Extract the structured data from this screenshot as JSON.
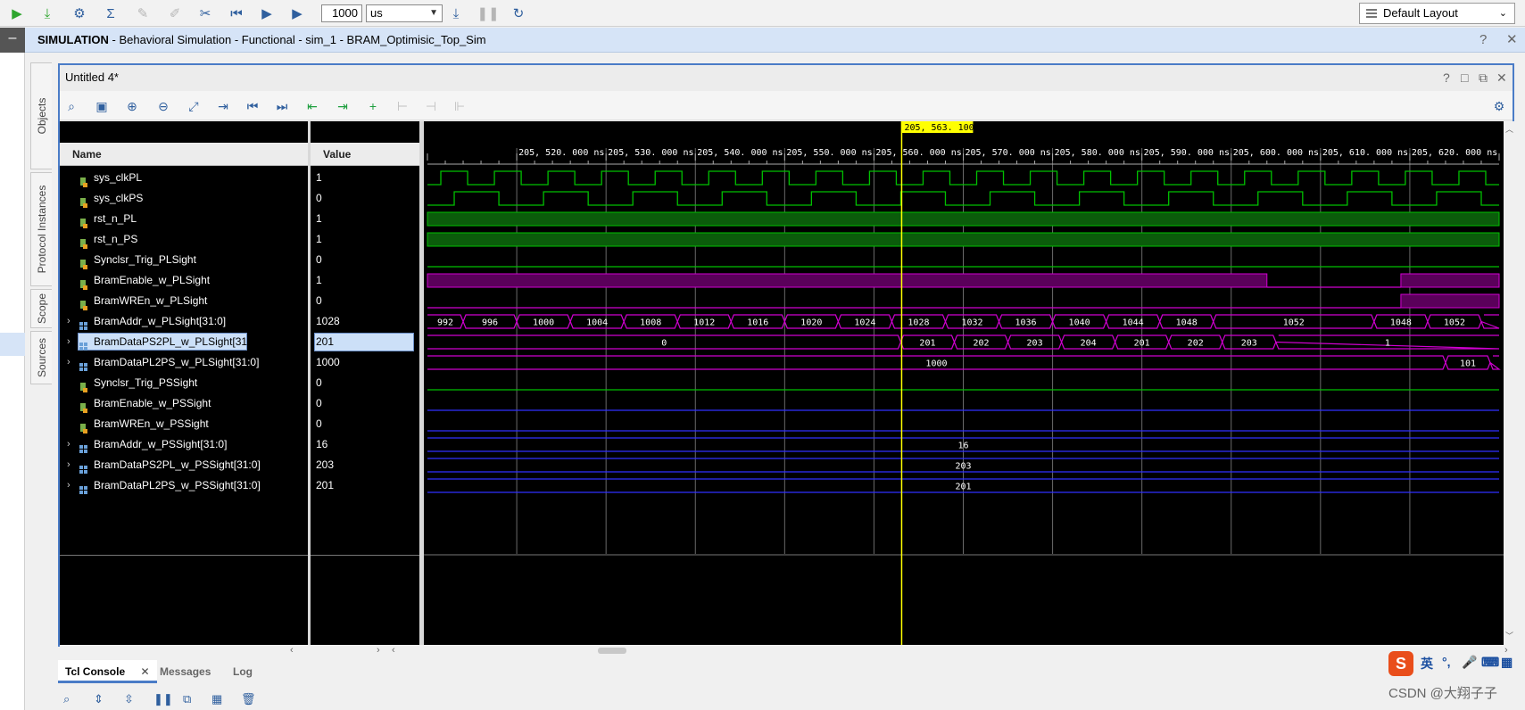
{
  "toolbar": {
    "run_time_value": "1000",
    "run_time_unit": "us",
    "layout": "Default Layout",
    "icons": [
      "run-all-icon",
      "run-step-icon",
      "settings-icon",
      "sigma-icon",
      "disabled-icon",
      "disabled-icon",
      "break-icon",
      "restart-icon",
      "run-icon",
      "run-for-time-icon",
      "load-icon",
      "pause-icon",
      "relaunch-icon"
    ]
  },
  "simulation": {
    "label_bold": "SIMULATION",
    "label_rest": " - Behavioral Simulation - Functional - sim_1 - BRAM_Optimisic_Top_Sim"
  },
  "side_tabs": [
    "Objects",
    "Protocol Instances",
    "Scope",
    "Sources"
  ],
  "wave_window": {
    "title": "Untitled 4*",
    "name_header": "Name",
    "value_header": "Value",
    "cursor_label": "205, 563. 100  ns",
    "cursor_time_ns": 205563.1
  },
  "signals": [
    {
      "name": "sys_clkPL",
      "value": "1",
      "kind": "bit"
    },
    {
      "name": "sys_clkPS",
      "value": "0",
      "kind": "bit"
    },
    {
      "name": "rst_n_PL",
      "value": "1",
      "kind": "bit"
    },
    {
      "name": "rst_n_PS",
      "value": "1",
      "kind": "bit"
    },
    {
      "name": "Synclsr_Trig_PLSight",
      "value": "0",
      "kind": "bit"
    },
    {
      "name": "BramEnable_w_PLSight",
      "value": "1",
      "kind": "bit"
    },
    {
      "name": "BramWREn_w_PLSight",
      "value": "0",
      "kind": "bit"
    },
    {
      "name": "BramAddr_w_PLSight[31:0]",
      "value": "1028",
      "kind": "bus"
    },
    {
      "name": "BramDataPS2PL_w_PLSight[31:0]",
      "value": "201",
      "kind": "bus",
      "selected": true
    },
    {
      "name": "BramDataPL2PS_w_PLSight[31:0]",
      "value": "1000",
      "kind": "bus"
    },
    {
      "name": "Synclsr_Trig_PSSight",
      "value": "0",
      "kind": "bit"
    },
    {
      "name": "BramEnable_w_PSSight",
      "value": "0",
      "kind": "bit"
    },
    {
      "name": "BramWREn_w_PSSight",
      "value": "0",
      "kind": "bit"
    },
    {
      "name": "BramAddr_w_PSSight[31:0]",
      "value": "16",
      "kind": "bus"
    },
    {
      "name": "BramDataPS2PL_w_PSSight[31:0]",
      "value": "203",
      "kind": "bus"
    },
    {
      "name": "BramDataPL2PS_w_PSSight[31:0]",
      "value": "201",
      "kind": "bus"
    }
  ],
  "time_axis": {
    "labels": [
      "205, 520. 000  ns",
      "205, 530. 000  ns",
      "205, 540. 000  ns",
      "205, 550. 000  ns",
      "205, 560. 000  ns",
      "205, 570. 000  ns",
      "205, 580. 000  ns",
      "205, 590. 000  ns",
      "205, 600. 000  ns",
      "205, 610. 000  ns",
      "205, 620. 000  ns"
    ],
    "start_ns": 205510.0,
    "end_ns": 205630.0
  },
  "bus_segments": {
    "BramAddr_w_PLSight": [
      {
        "t0": 205510,
        "t1": 205514,
        "v": "992"
      },
      {
        "t0": 205514,
        "t1": 205520,
        "v": "996"
      },
      {
        "t0": 205520,
        "t1": 205526,
        "v": "1000"
      },
      {
        "t0": 205526,
        "t1": 205532,
        "v": "1004"
      },
      {
        "t0": 205532,
        "t1": 205538,
        "v": "1008"
      },
      {
        "t0": 205538,
        "t1": 205544,
        "v": "1012"
      },
      {
        "t0": 205544,
        "t1": 205550,
        "v": "1016"
      },
      {
        "t0": 205550,
        "t1": 205556,
        "v": "1020"
      },
      {
        "t0": 205556,
        "t1": 205562,
        "v": "1024"
      },
      {
        "t0": 205562,
        "t1": 205568,
        "v": "1028"
      },
      {
        "t0": 205568,
        "t1": 205574,
        "v": "1032"
      },
      {
        "t0": 205574,
        "t1": 205580,
        "v": "1036"
      },
      {
        "t0": 205580,
        "t1": 205586,
        "v": "1040"
      },
      {
        "t0": 205586,
        "t1": 205592,
        "v": "1044"
      },
      {
        "t0": 205592,
        "t1": 205598,
        "v": "1048"
      },
      {
        "t0": 205598,
        "t1": 205616,
        "v": "1052"
      },
      {
        "t0": 205616,
        "t1": 205622,
        "v": "1048"
      },
      {
        "t0": 205622,
        "t1": 205628,
        "v": "1052"
      },
      {
        "t0": 205628,
        "t1": 205630,
        "v": ""
      }
    ],
    "BramDataPS2PL_w_PLSight": [
      {
        "t0": 205510,
        "t1": 205563,
        "v": "0"
      },
      {
        "t0": 205563,
        "t1": 205569,
        "v": "201"
      },
      {
        "t0": 205569,
        "t1": 205575,
        "v": "202"
      },
      {
        "t0": 205575,
        "t1": 205581,
        "v": "203"
      },
      {
        "t0": 205581,
        "t1": 205587,
        "v": "204"
      },
      {
        "t0": 205587,
        "t1": 205593,
        "v": "201"
      },
      {
        "t0": 205593,
        "t1": 205599,
        "v": "202"
      },
      {
        "t0": 205599,
        "t1": 205605,
        "v": "203"
      },
      {
        "t0": 205605,
        "t1": 205630,
        "v": "1"
      }
    ],
    "BramDataPL2PS_w_PLSight": [
      {
        "t0": 205510,
        "t1": 205624,
        "v": "1000"
      },
      {
        "t0": 205624,
        "t1": 205629,
        "v": "101"
      },
      {
        "t0": 205629,
        "t1": 205630,
        "v": ""
      }
    ],
    "BramAddr_w_PSSight": [
      {
        "t0": 205510,
        "t1": 205630,
        "v": "16"
      }
    ],
    "BramDataPS2PL_w_PSSight": [
      {
        "t0": 205510,
        "t1": 205630,
        "v": "203"
      }
    ],
    "BramDataPL2PS_w_PSSight": [
      {
        "t0": 205510,
        "t1": 205630,
        "v": "201"
      }
    ]
  },
  "colors": {
    "wave_green": "#00c000",
    "wave_fill_green": "#0b5c0b",
    "wave_magenta": "#d000d0",
    "wave_fill_magenta": "#5a005a",
    "wave_blue": "#3030ff",
    "cursor": "#ffff00",
    "grid": "#6a6a6a"
  },
  "console": {
    "tabs": [
      "Tcl Console",
      "Messages",
      "Log"
    ]
  },
  "watermark": "CSDN @大翔子子",
  "ime": {
    "s": "S",
    "lang": "英"
  }
}
